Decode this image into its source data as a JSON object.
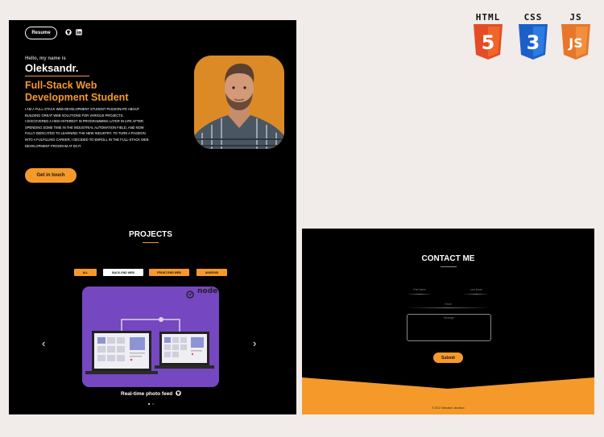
{
  "hero": {
    "resume_label": "Resume",
    "greeting": "Hello, my name is",
    "name": "Oleksandr.",
    "role_line1": "Full-Stack Web",
    "role_line2": "Development Student",
    "bio": [
      "I am a full-stack web development student passionate about",
      "building great web solutions for various projects.",
      "I discovered a high interest in programming later in life after",
      "spending some time in the industrial automation field, and now",
      "fully dedicated to learning the new industry. To turn a passion",
      "into a fulfilling career, I decided to enroll in the full-stack web",
      "development program at BCIT."
    ],
    "cta_label": "Get in touch"
  },
  "projects": {
    "title": "PROJECTS",
    "filters": [
      "ALL",
      "BACK-END WEB",
      "FRONT-END WEB",
      "ANDROID"
    ],
    "active_filter": "BACK-END WEB",
    "card_badge": "node",
    "card_caption": "Real-time photo feed",
    "slides": 2,
    "current_slide": 1
  },
  "tech_logos": [
    {
      "label": "HTML",
      "digit": "5",
      "color": "#e34c26"
    },
    {
      "label": "CSS",
      "digit": "3",
      "color": "#2965f1"
    },
    {
      "label": "JS",
      "digit": "JS",
      "color": "#f0892f"
    }
  ],
  "contact": {
    "title": "CONTACT ME",
    "first_name": "First Name",
    "last_name": "Last Name",
    "email": "Email",
    "message": "Message",
    "submit_label": "Submit",
    "footer": "© 2022 Oleksandr Jacobson"
  },
  "colors": {
    "accent": "#f59a2a",
    "card": "#7547c0",
    "background": "#f1ebe9"
  }
}
